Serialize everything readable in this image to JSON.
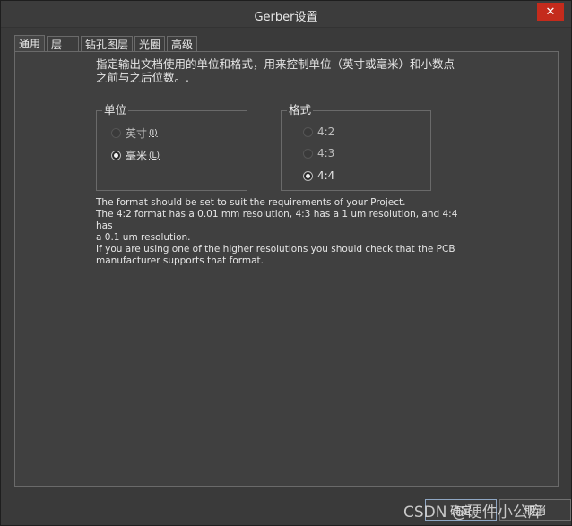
{
  "window": {
    "title": "Gerber设置",
    "close_glyph": "✕"
  },
  "tabs": [
    {
      "label": "通用",
      "active": true
    },
    {
      "label": "层",
      "active": false
    },
    {
      "label": "钻孔图层",
      "active": false
    },
    {
      "label": "光圈",
      "active": false
    },
    {
      "label": "高级",
      "active": false
    }
  ],
  "description": {
    "line1": "指定输出文档使用的单位和格式，用来控制单位（英寸或毫米）和小数点",
    "line2": "之前与之后位数。."
  },
  "units_group": {
    "label": "单位",
    "options": [
      {
        "label": "英寸",
        "accel": "(I)",
        "selected": false
      },
      {
        "label": "毫米",
        "accel": "(L)",
        "selected": true
      }
    ]
  },
  "format_group": {
    "label": "格式",
    "options": [
      {
        "label": "4:2",
        "selected": false
      },
      {
        "label": "4:3",
        "selected": false
      },
      {
        "label": "4:4",
        "selected": true
      }
    ]
  },
  "info": {
    "line1": "The format should be set to suit the requirements of your Project.",
    "line2": "The 4:2 format has a 0.01 mm resolution, 4:3 has a 1 um resolution, and 4:4 has",
    "line3": "a 0.1 um resolution.",
    "line4": "If you are using one of the higher resolutions you should check that the PCB",
    "line5": "manufacturer supports that format."
  },
  "buttons": {
    "ok": "确定",
    "cancel": "取消"
  },
  "watermark": "CSDN @硬件小公库",
  "colors": {
    "background": "#404040",
    "close": "#c42b1c",
    "border": "#6a6a6a"
  }
}
